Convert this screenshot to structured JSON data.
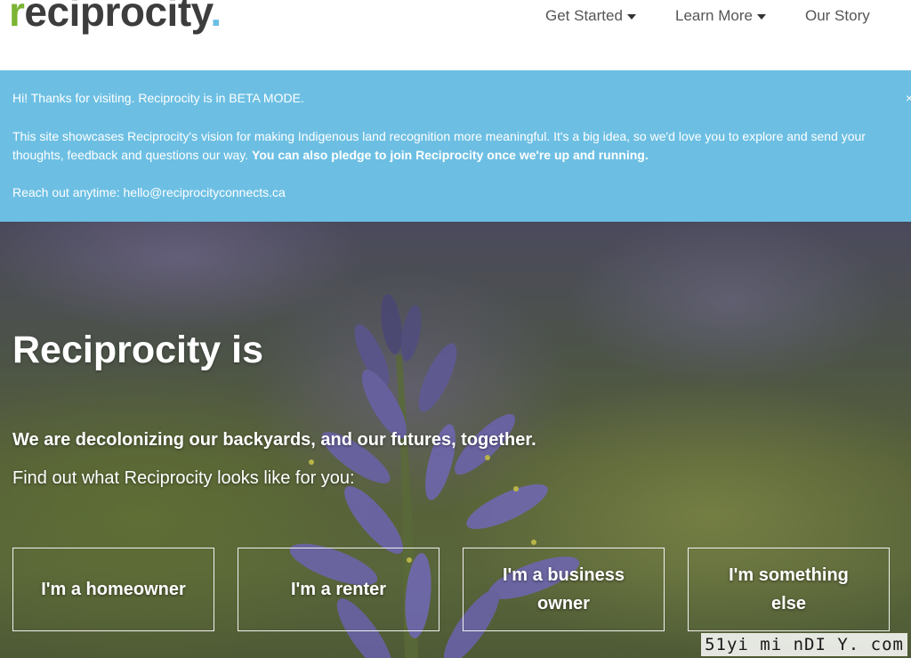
{
  "header": {
    "logo": {
      "first_letter": "r",
      "rest": "eciprocity",
      "dot": "."
    },
    "nav": [
      {
        "label": "Get Started",
        "has_dropdown": true
      },
      {
        "label": "Learn More",
        "has_dropdown": true
      },
      {
        "label": "Our Story",
        "has_dropdown": false
      }
    ]
  },
  "banner": {
    "line1": "Hi! Thanks for visiting. Reciprocity is in BETA MODE.",
    "line2": "This site showcases Reciprocity's vision for making Indigenous land recognition more meaningful. It's a big idea, so we'd love you to explore and send your thoughts, feedback and questions our way.",
    "line2_bold": "You can also pledge to join Reciprocity once we're up and running.",
    "line3": "Reach out anytime: hello@reciprocityconnects.ca",
    "close_glyph": "×"
  },
  "hero": {
    "title": "Reciprocity is",
    "tagline": "We are decolonizing our backyards, and our futures, together.",
    "subtitle": "Find out what Reciprocity looks like for you:",
    "choices": [
      "I'm a homeowner",
      "I'm a renter",
      "I'm a business owner",
      "I'm something else"
    ]
  },
  "watermark": "51yi mi nDI Y. com",
  "colors": {
    "banner_bg": "#6cbfe3",
    "logo_green": "#7bb534",
    "logo_dot_blue": "#6bbfe4",
    "logo_text": "#3d3d3d",
    "nav_text": "#555555"
  },
  "icons": {
    "dropdown": "caret-down-icon",
    "close": "close-icon"
  }
}
